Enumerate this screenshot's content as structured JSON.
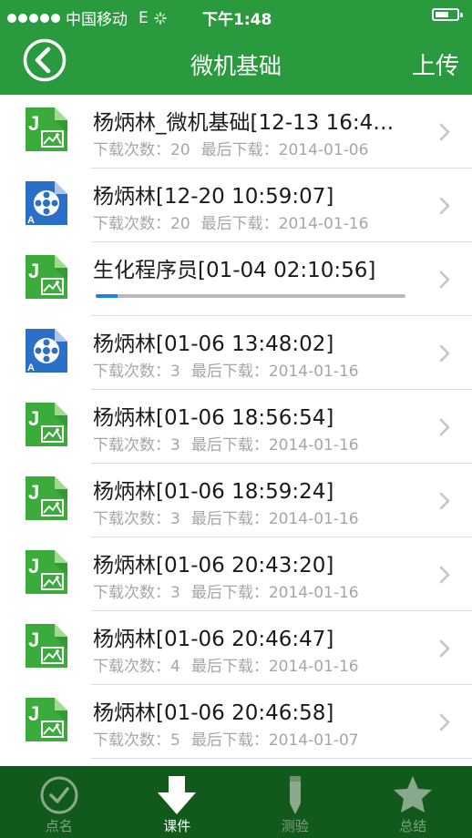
{
  "status_bar": {
    "carrier": "中国移动",
    "network": "E",
    "time": "下午1:48",
    "battery_level": 0.65
  },
  "nav": {
    "title": "微机基础",
    "upload_label": "上传",
    "back_icon": "back-circle-icon"
  },
  "list": {
    "items": [
      {
        "title": "杨炳林_微机基础[12-13 16:4…",
        "icon": "j-image-file-icon",
        "downloads_label": "下载次数：20",
        "last_label": "最后下载：2014-01-06",
        "downloading": false
      },
      {
        "title": "杨炳林[12-20 10:59:07]",
        "icon": "video-reel-file-icon",
        "downloads_label": "下载次数：20",
        "last_label": "最后下载：2014-01-16",
        "downloading": false
      },
      {
        "title": "生化程序员[01-04 02:10:56]",
        "icon": "j-image-file-icon",
        "downloads_label": "",
        "last_label": "",
        "downloading": true,
        "progress": 0.07
      },
      {
        "title": "杨炳林[01-06 13:48:02]",
        "icon": "video-reel-file-icon",
        "downloads_label": "下载次数：3",
        "last_label": "最后下载：2014-01-16",
        "downloading": false
      },
      {
        "title": "杨炳林[01-06 18:56:54]",
        "icon": "j-image-file-icon",
        "downloads_label": "下载次数：3",
        "last_label": "最后下载：2014-01-16",
        "downloading": false
      },
      {
        "title": "杨炳林[01-06 18:59:24]",
        "icon": "j-image-file-icon",
        "downloads_label": "下载次数：3",
        "last_label": "最后下载：2014-01-16",
        "downloading": false
      },
      {
        "title": "杨炳林[01-06 20:43:20]",
        "icon": "j-image-file-icon",
        "downloads_label": "下载次数：3",
        "last_label": "最后下载：2014-01-16",
        "downloading": false
      },
      {
        "title": "杨炳林[01-06 20:46:47]",
        "icon": "j-image-file-icon",
        "downloads_label": "下载次数：4",
        "last_label": "最后下载：2014-01-16",
        "downloading": false
      },
      {
        "title": "杨炳林[01-06 20:46:58]",
        "icon": "j-image-file-icon",
        "downloads_label": "下载次数：5",
        "last_label": "最后下载：2014-01-07",
        "downloading": false
      },
      {
        "title": "",
        "icon": "j-image-file-icon",
        "downloads_label": "",
        "last_label": "",
        "downloading": false
      }
    ]
  },
  "tab_bar": {
    "tabs": [
      {
        "label": "点名",
        "icon": "check-circle-icon",
        "active": false
      },
      {
        "label": "课件",
        "icon": "download-arrow-icon",
        "active": true
      },
      {
        "label": "测验",
        "icon": "pencil-icon",
        "active": false
      },
      {
        "label": "总结",
        "icon": "star-icon",
        "active": false
      }
    ]
  },
  "colors": {
    "header_green": "#2a9a3f",
    "tabbar_green": "#125a1c",
    "progress_blue": "#1e7ff0",
    "j_icon_green": "#3bab3c",
    "video_icon_blue": "#2c6fc9"
  }
}
